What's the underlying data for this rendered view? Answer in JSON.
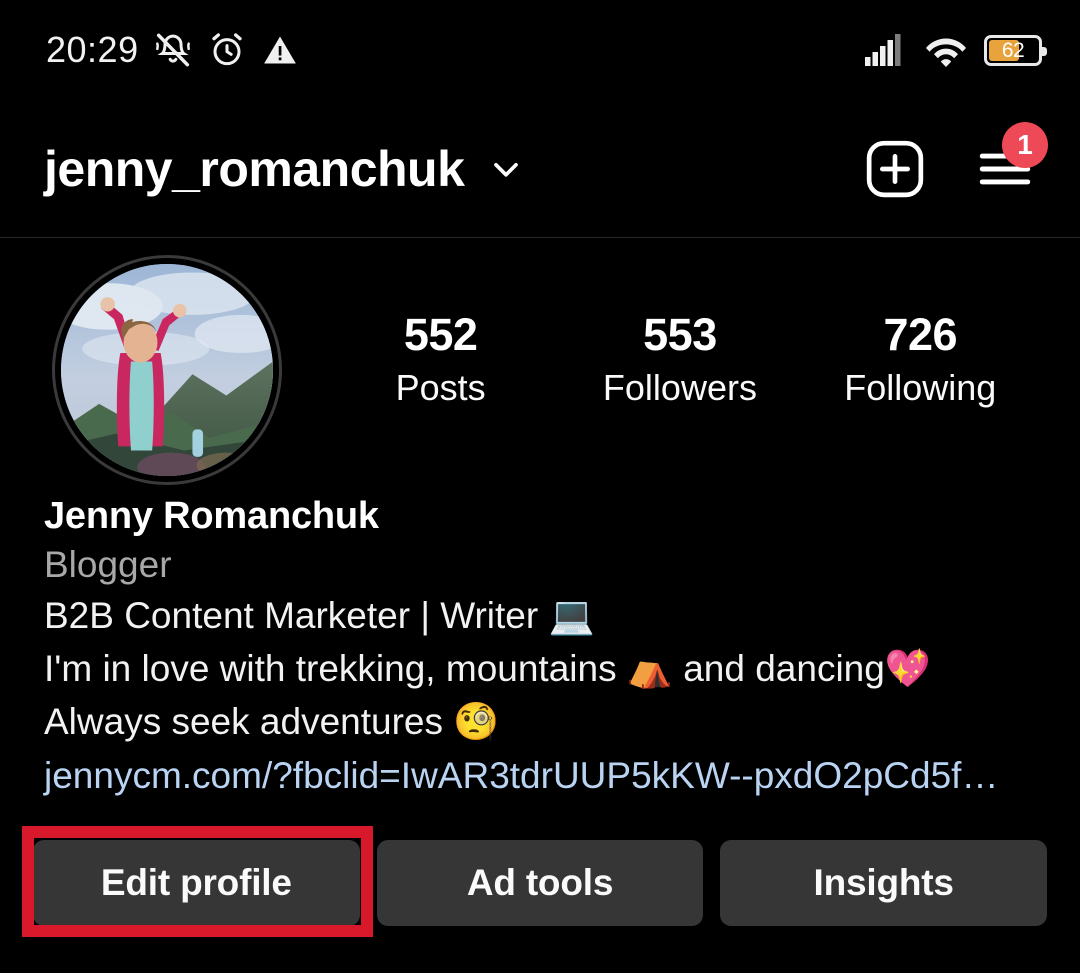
{
  "statusbar": {
    "time": "20:29",
    "icons_left": [
      "bell-muted-icon",
      "alarm-clock-icon",
      "warning-triangle-icon"
    ],
    "icons_right": [
      "cellular-signal-icon",
      "wifi-icon",
      "battery-icon"
    ],
    "battery_percent": "62",
    "battery_fill_color": "#e8a33d"
  },
  "appbar": {
    "username": "jenny_romanchuk",
    "dropdown_icon": "chevron-down-icon",
    "create_icon": "plus-square-icon",
    "menu_icon": "hamburger-menu-icon",
    "menu_badge_count": "1",
    "badge_color": "#ED4956"
  },
  "profile": {
    "avatar_name": "profile-avatar",
    "stats": [
      {
        "value": "552",
        "label": "Posts"
      },
      {
        "value": "553",
        "label": "Followers"
      },
      {
        "value": "726",
        "label": "Following"
      }
    ],
    "display_name": "Jenny Romanchuk",
    "category": "Blogger",
    "bio_line_1": "B2B Content Marketer | Writer 💻",
    "bio_line_2": "I'm in love with trekking, mountains ⛺ and dancing💖",
    "bio_line_3": "Always seek adventures 🧐",
    "link": "jennycm.com/?fbclid=IwAR3tdrUUP5kKW--pxdO2pCd5f…",
    "link_color": "#b9d3f2"
  },
  "actions": {
    "edit_profile_label": "Edit profile",
    "ad_tools_label": "Ad tools",
    "insights_label": "Insights"
  },
  "annotation": {
    "highlight_color": "#D8192B",
    "target": "edit-profile-button"
  }
}
